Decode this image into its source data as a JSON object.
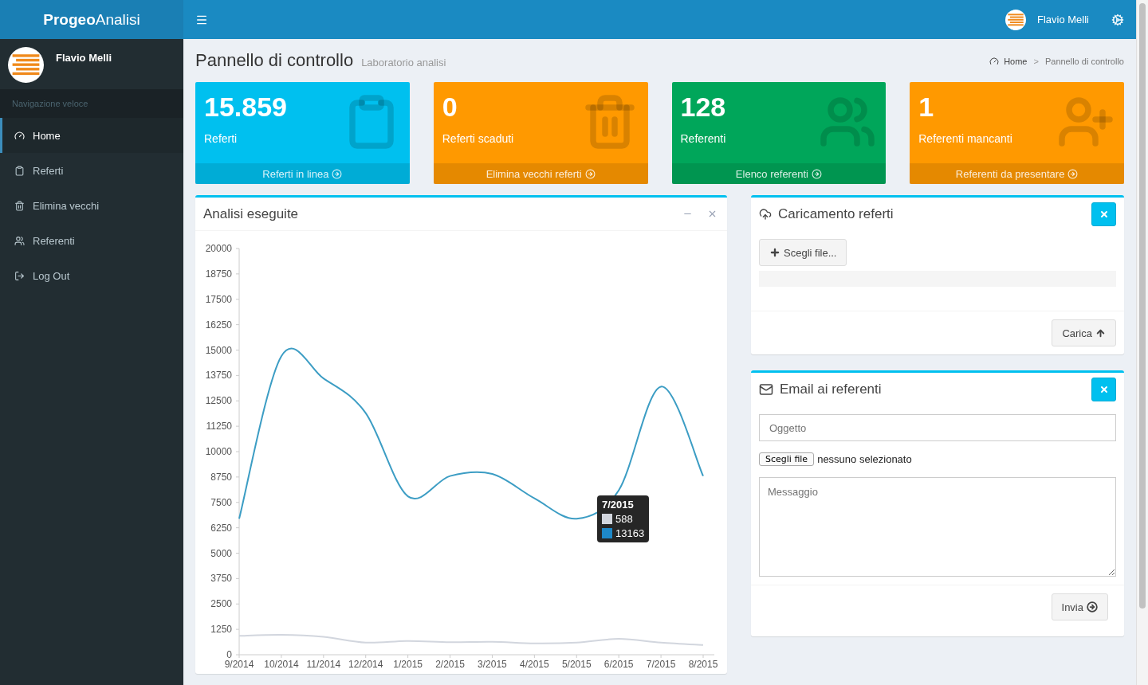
{
  "brand": {
    "bold": "Progeo",
    "light": "Analisi"
  },
  "header": {
    "user": "Flavio Melli"
  },
  "sidebar": {
    "user": "Flavio Melli",
    "section": "Navigazione veloce",
    "items": [
      {
        "label": "Home",
        "selected": true
      },
      {
        "label": "Referti",
        "selected": false
      },
      {
        "label": "Elimina vecchi",
        "selected": false
      },
      {
        "label": "Referenti",
        "selected": false
      },
      {
        "label": "Log Out",
        "selected": false
      }
    ]
  },
  "page": {
    "title": "Pannello di controllo",
    "subtitle": "Laboratorio analisi",
    "breadcrumb": [
      "Home",
      "Pannello di controllo"
    ],
    "breadcrumb_separator": ">"
  },
  "stats": [
    {
      "value": "15.859",
      "label": "Referti",
      "link": "Referti in linea",
      "color": "#00c0ef"
    },
    {
      "value": "0",
      "label": "Referti scaduti",
      "link": "Elimina vecchi referti",
      "color": "#ff9900"
    },
    {
      "value": "128",
      "label": "Referenti",
      "link": "Elenco referenti",
      "color": "#00a65a"
    },
    {
      "value": "1",
      "label": "Referenti mancanti",
      "link": "Referenti da presentare",
      "color": "#ff9900"
    }
  ],
  "chart_box": {
    "title": "Analisi eseguite",
    "chart_data": {
      "type": "line",
      "categories": [
        "9/2014",
        "10/2014",
        "11/2014",
        "12/2014",
        "1/2015",
        "2/2015",
        "3/2015",
        "4/2015",
        "5/2015",
        "6/2015",
        "7/2015",
        "8/2015"
      ],
      "ylim": [
        0,
        20000
      ],
      "yticks": [
        0,
        1250,
        2500,
        3750,
        5000,
        6250,
        7500,
        8750,
        10000,
        11250,
        12500,
        13750,
        15000,
        16250,
        17500,
        18750,
        20000
      ],
      "series": [
        {
          "color": "#d2d6de",
          "values": [
            930,
            980,
            880,
            600,
            680,
            620,
            640,
            560,
            600,
            780,
            600,
            480
          ]
        },
        {
          "color": "#3c9dc4",
          "values": [
            6700,
            14700,
            13600,
            11900,
            7800,
            8800,
            8900,
            7700,
            6700,
            8100,
            13200,
            8800
          ]
        }
      ]
    },
    "tooltip": {
      "title": "7/2015",
      "items": [
        {
          "value": "588",
          "color": "#d2d6de"
        },
        {
          "value": "13163",
          "color": "#1e88c8"
        }
      ]
    }
  },
  "upload_box": {
    "title": "Caricamento referti",
    "choose": "Scegli file...",
    "submit": "Carica",
    "progress": {
      "level": 0
    }
  },
  "email_box": {
    "title": "Email ai referenti",
    "subject_placeholder": "Oggetto",
    "file_button": "Scegli file",
    "file_status": "nessuno selezionato",
    "message_placeholder": "Messaggio",
    "submit": "Invia"
  }
}
